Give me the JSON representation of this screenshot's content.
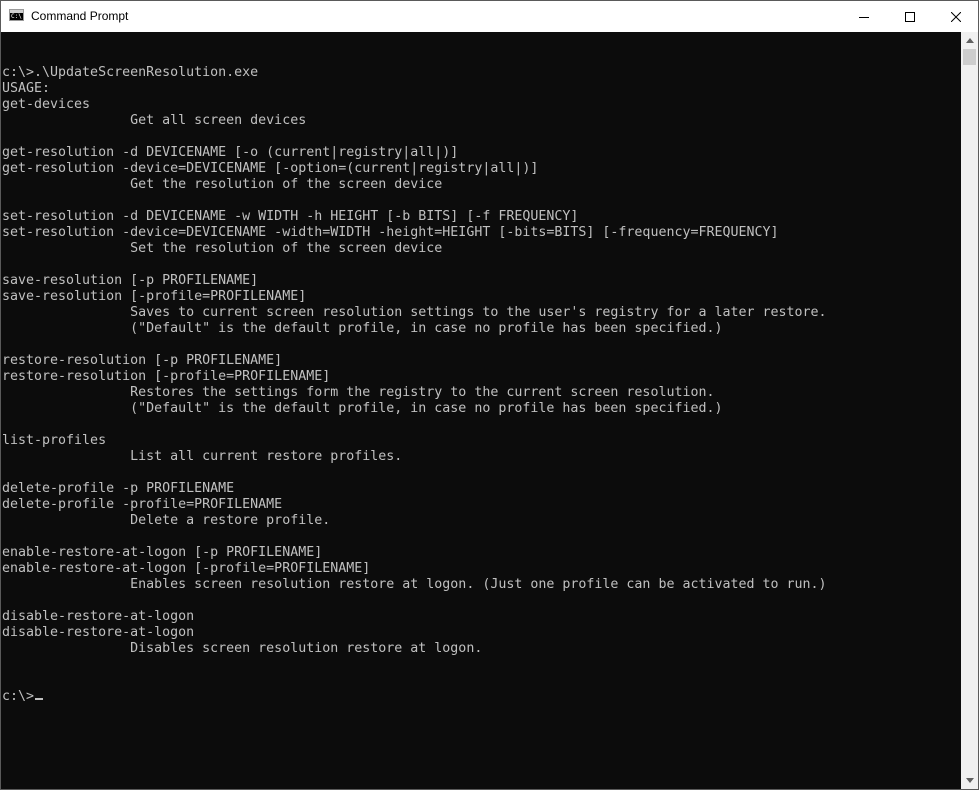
{
  "window": {
    "title": "Command Prompt",
    "app_icon_text": "C:\\"
  },
  "console": {
    "lines": [
      "c:\\>.\\UpdateScreenResolution.exe",
      "USAGE:",
      "get-devices",
      "                Get all screen devices",
      "",
      "get-resolution -d DEVICENAME [-o (current|registry|all|)]",
      "get-resolution -device=DEVICENAME [-option=(current|registry|all|)]",
      "                Get the resolution of the screen device",
      "",
      "set-resolution -d DEVICENAME -w WIDTH -h HEIGHT [-b BITS] [-f FREQUENCY]",
      "set-resolution -device=DEVICENAME -width=WIDTH -height=HEIGHT [-bits=BITS] [-frequency=FREQUENCY]",
      "                Set the resolution of the screen device",
      "",
      "save-resolution [-p PROFILENAME]",
      "save-resolution [-profile=PROFILENAME]",
      "                Saves to current screen resolution settings to the user's registry for a later restore.",
      "                (\"Default\" is the default profile, in case no profile has been specified.)",
      "",
      "restore-resolution [-p PROFILENAME]",
      "restore-resolution [-profile=PROFILENAME]",
      "                Restores the settings form the registry to the current screen resolution.",
      "                (\"Default\" is the default profile, in case no profile has been specified.)",
      "",
      "list-profiles",
      "                List all current restore profiles.",
      "",
      "delete-profile -p PROFILENAME",
      "delete-profile -profile=PROFILENAME",
      "                Delete a restore profile.",
      "",
      "enable-restore-at-logon [-p PROFILENAME]",
      "enable-restore-at-logon [-profile=PROFILENAME]",
      "                Enables screen resolution restore at logon. (Just one profile can be activated to run.)",
      "",
      "disable-restore-at-logon",
      "disable-restore-at-logon",
      "                Disables screen resolution restore at logon.",
      "",
      ""
    ],
    "prompt": "c:\\>"
  },
  "icons": {
    "minimize": "minimize-icon",
    "maximize": "maximize-icon",
    "close": "close-icon",
    "scroll_up": "scroll-up-arrow-icon",
    "scroll_down": "scroll-down-arrow-icon"
  },
  "colors": {
    "console_bg": "#0c0c0c",
    "console_text": "#c0c0c0"
  }
}
